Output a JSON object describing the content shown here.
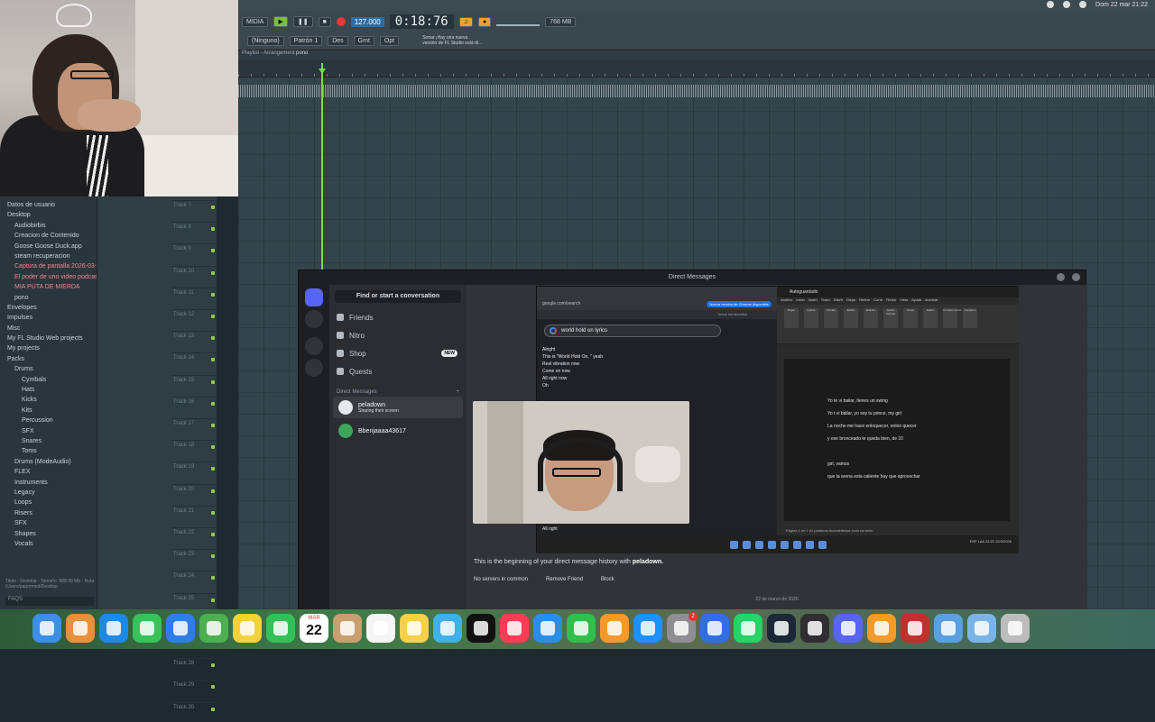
{
  "menubar": {
    "datetime": "Dom 22 mar 21:22"
  },
  "fl": {
    "menu_label": "MIDIA",
    "time": "0:18:76",
    "tempo": "127.000",
    "pattern": "Patrón 1",
    "mode": "(Ninguno)",
    "row2_btns": [
      "Des",
      "Gmt",
      "Opt"
    ],
    "hint_line1": "Sonar ¡Hay una nueva",
    "hint_line2": "versión de FL Studio está di...",
    "mem": "768 MB",
    "playlist_title": "Playlist - Arrangement",
    "playlist_name": "pono"
  },
  "browser": {
    "items": [
      "Datos de usuario",
      "Desktop",
      "Audiobirbis",
      "Creacion de Contenido",
      "Goose Goose Duck.app",
      "steam recuperacion",
      "Captura de pantalla 2026-03-15 06.2...",
      "El poder de uno video podcast",
      "MIA PUTA DE MIERDA",
      "pono",
      "Envelopes",
      "Impulses",
      "Misc",
      "My FL Studio Web projects",
      "My projects",
      "Packs",
      "Drums",
      "Cymbals",
      "Hats",
      "Kicks",
      "Kits",
      "Percussion",
      "SFX",
      "Snares",
      "Toms",
      "Drums (ModeAudio)",
      "FLEX",
      "Instruments",
      "Legacy",
      "Loops",
      "Risers",
      "SFX",
      "Shapes",
      "Vocals"
    ],
    "footer": "Titulo : Desktop · Tamaño: 888.99 Mb · Ruta : /Users/pauremed/Desktop",
    "search": "FAQS"
  },
  "tracks": [
    "Track 7",
    "Track 8",
    "Track 9",
    "Track 10",
    "Track 11",
    "Track 12",
    "Track 13",
    "Track 14",
    "Track 15",
    "Track 16",
    "Track 17",
    "Track 18",
    "Track 19",
    "Track 20",
    "Track 21",
    "Track 22",
    "Track 23",
    "Track 24",
    "Track 25",
    "Track 26",
    "Track 27",
    "Track 28",
    "Track 29",
    "Track 30"
  ],
  "discord": {
    "title": "Direct Messages",
    "search": "Find or start a conversation",
    "nav": [
      {
        "label": "Friends",
        "icon": "friends-icon"
      },
      {
        "label": "Nitro",
        "icon": "nitro-icon"
      },
      {
        "label": "Shop",
        "icon": "shop-icon",
        "badge": "NEW"
      },
      {
        "label": "Quests",
        "icon": "quests-icon"
      }
    ],
    "dm_header": "Direct Messages",
    "dms": [
      {
        "name": "peladown",
        "status": "Sharing their screen"
      },
      {
        "name": "Bbenjaaaa43617",
        "status": ""
      }
    ],
    "begin_text": "This is the beginning of your direct message history with",
    "begin_user": "peladown.",
    "no_servers": "No servers in common",
    "remove_friend": "Remove Friend",
    "block": "Block",
    "date": "22 de marzo de 2026"
  },
  "share": {
    "chrome": {
      "addr": "google.com/search",
      "update_btn": "Nueva versión de Chrome disponible",
      "bookmarks": "Todos los favoritos",
      "query": "world hold on lyrics",
      "lyrics": [
        "Alright",
        "This is \"World Hold On, \" yeah",
        "Real vibration now",
        "Come on now",
        "All right now",
        "Oh"
      ],
      "last_line": "All right"
    },
    "word": {
      "title": "Autoguardado",
      "menu": [
        "Archivo",
        "Inicio",
        "Insert",
        "Trazo",
        "Diseñ",
        "Dispo",
        "Refere",
        "Corre",
        "Revisi",
        "Vista",
        "Ayuda",
        "Acrobat"
      ],
      "ribbon": [
        "Pegar",
        "Fuente",
        "Párrafo",
        "Estilos",
        "Edición",
        "Adobe Acrobat",
        "Dictar",
        "Editor",
        "Complementos",
        "Complem"
      ],
      "doc_lines": [
        "Yo te vi bailar, tienes un swing",
        "Yo t vi bailar, yo soy tu prince, my girl",
        "La noche me hace enloquecer, enloo quecer",
        "y ese bronceado te queda bien, de 10",
        "",
        "girl, vamos",
        "que la arena esta caliente hay que aprovechar"
      ],
      "status": "Página 1 de 1   62 palabras   Accesibilidad: todo correcto"
    },
    "tray": "ESP LAA  22:22 22/3/2026"
  },
  "dock": {
    "calendar_month": "MAR",
    "calendar_day": "22",
    "settings_badge": "2"
  }
}
